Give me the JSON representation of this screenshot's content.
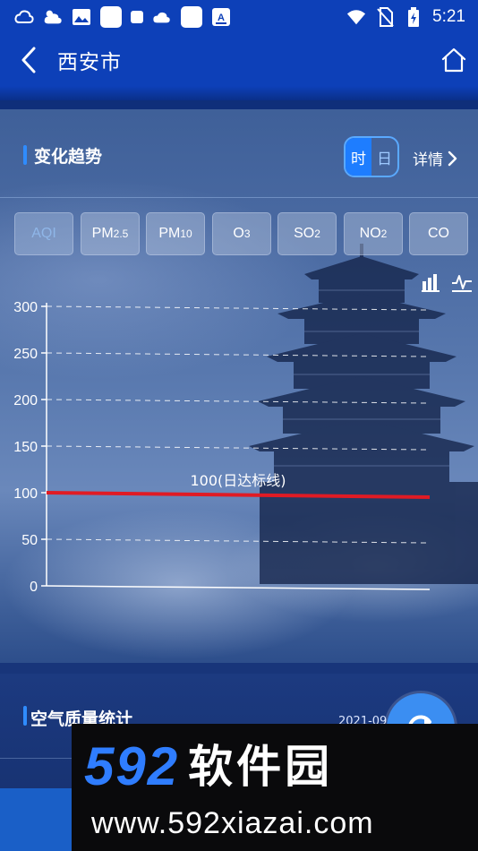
{
  "status_bar": {
    "time": "5:21",
    "left_icons": [
      "cloud-icon",
      "partly-cloudy-icon",
      "image-icon",
      "app-icon",
      "app-icon",
      "cloud-icon",
      "app-icon",
      "font-icon"
    ],
    "right_icons": [
      "wifi-icon",
      "no-sim-icon",
      "battery-icon"
    ]
  },
  "header": {
    "title": "西安市",
    "back_icon": "chevron-left-icon",
    "home_icon": "home-icon"
  },
  "trend_section": {
    "title": "变化趋势",
    "toggle": {
      "options": [
        "时",
        "日"
      ],
      "selected": "时"
    },
    "detail_label": "详情"
  },
  "pollutant_tabs": [
    {
      "base": "AQI",
      "sub": "",
      "active": true
    },
    {
      "base": "PM",
      "sub": "2.5",
      "active": false
    },
    {
      "base": "PM",
      "sub": "10",
      "active": false
    },
    {
      "base": "O",
      "sub": "3",
      "active": false
    },
    {
      "base": "SO",
      "sub": "2",
      "active": false
    },
    {
      "base": "NO",
      "sub": "2",
      "active": false
    },
    {
      "base": "CO",
      "sub": "",
      "active": false
    }
  ],
  "chart_view_icons": [
    "bar-chart-icon",
    "line-chart-icon"
  ],
  "chart_data": {
    "type": "line",
    "title": "",
    "xlabel": "",
    "ylabel": "",
    "ylim": [
      0,
      300
    ],
    "yticks": [
      "0",
      "50",
      "100",
      "150",
      "200",
      "250",
      "300"
    ],
    "grid": true,
    "series": [],
    "reference_line": {
      "label": "100(日达标线)",
      "value": 100,
      "color": "#e01b24"
    }
  },
  "stats_section": {
    "title": "空气质量统计",
    "date_text": "2021-09",
    "refresh_icon": "refresh-icon"
  },
  "watermark": {
    "number": "592",
    "name": "软件园",
    "url": "www.592xiazai.com"
  },
  "colors": {
    "header_bg": "#0d40b8",
    "accent": "#2f8cff",
    "reference_line": "#e01b24"
  }
}
